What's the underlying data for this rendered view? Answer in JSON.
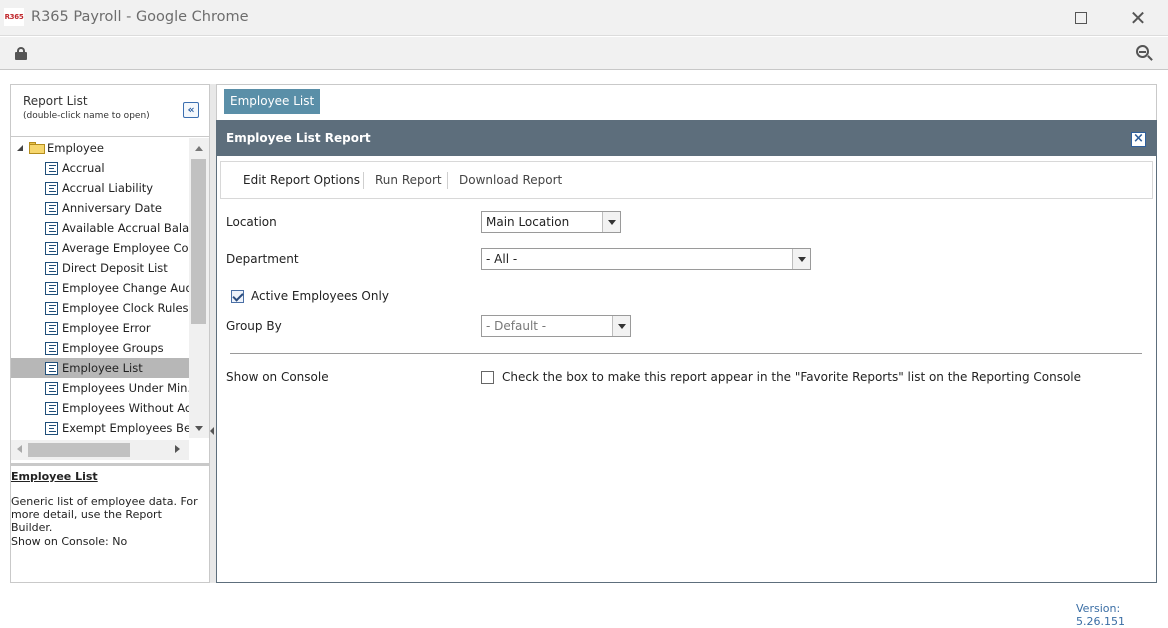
{
  "window": {
    "app_icon_text": "R365",
    "title": "R365 Payroll - Google Chrome"
  },
  "browser": {
    "icons": [
      "lock-icon",
      "zoom-out-icon"
    ]
  },
  "report_list": {
    "title": "Report List",
    "subtitle": "(double-click name to open)",
    "collapse_glyph": "«",
    "folder": "Employee",
    "items": [
      "Accrual",
      "Accrual Liability",
      "Anniversary Date",
      "Available Accrual Balance",
      "Average Employee Count",
      "Direct Deposit List",
      "Employee Change Audit",
      "Employee Clock Rules",
      "Employee Error",
      "Employee Groups",
      "Employee List",
      "Employees Under Min. Wage",
      "Employees Without Accruals",
      "Exempt Employees Below"
    ],
    "selected_item": "Employee List"
  },
  "description": {
    "title": "Employee List",
    "text": "Generic list of employee data. For more detail, use the Report Builder.",
    "console": "Show on Console: No"
  },
  "tabs": {
    "active": "Employee List"
  },
  "report": {
    "title": "Employee List Report",
    "close_glyph": "×",
    "subtabs": [
      "Edit Report Options",
      "Run Report",
      "Download Report"
    ],
    "active_subtab": "Edit Report Options",
    "location": {
      "label": "Location",
      "value": "Main Location"
    },
    "department": {
      "label": "Department",
      "value": "- All -"
    },
    "active_only": {
      "label": "Active Employees Only",
      "checked": true
    },
    "group_by": {
      "label": "Group By",
      "value": "- Default -"
    },
    "show_on_console": {
      "label": "Show on Console",
      "checkbox_text": "Check the box to make this report appear in the \"Favorite Reports\" list on the Reporting Console",
      "checked": false
    }
  },
  "footer": {
    "version": "Version: 5.26.151"
  },
  "colors": {
    "panel_header": "#5d6e7c",
    "tab_chip": "#5a8fa8",
    "selected_row": "#b7b7b7",
    "version_text": "#3a6ea5"
  }
}
